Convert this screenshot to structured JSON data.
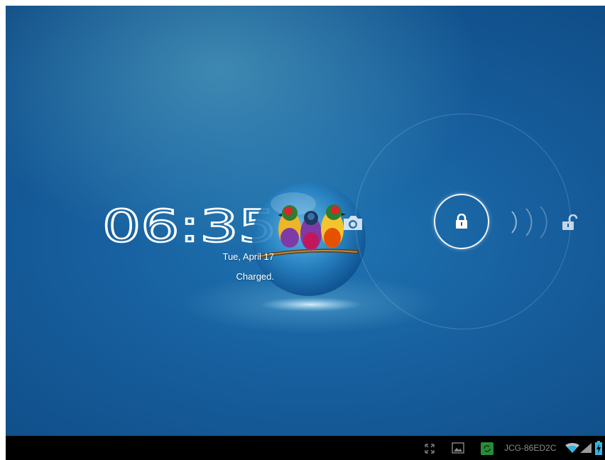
{
  "lockscreen": {
    "time": "06:35",
    "date": "Tue, April 17",
    "battery_status": "Charged."
  },
  "status_bar": {
    "network_name": "JCG-86ED2C",
    "icons": [
      "expand-screen-icon",
      "gallery-icon",
      "sync-icon",
      "wifi-icon",
      "signal-icon",
      "battery-charging-icon"
    ]
  },
  "colors": {
    "wallpaper_base": "#175f9e",
    "navbar": "#000000",
    "sync_green": "#2a8a3a"
  }
}
